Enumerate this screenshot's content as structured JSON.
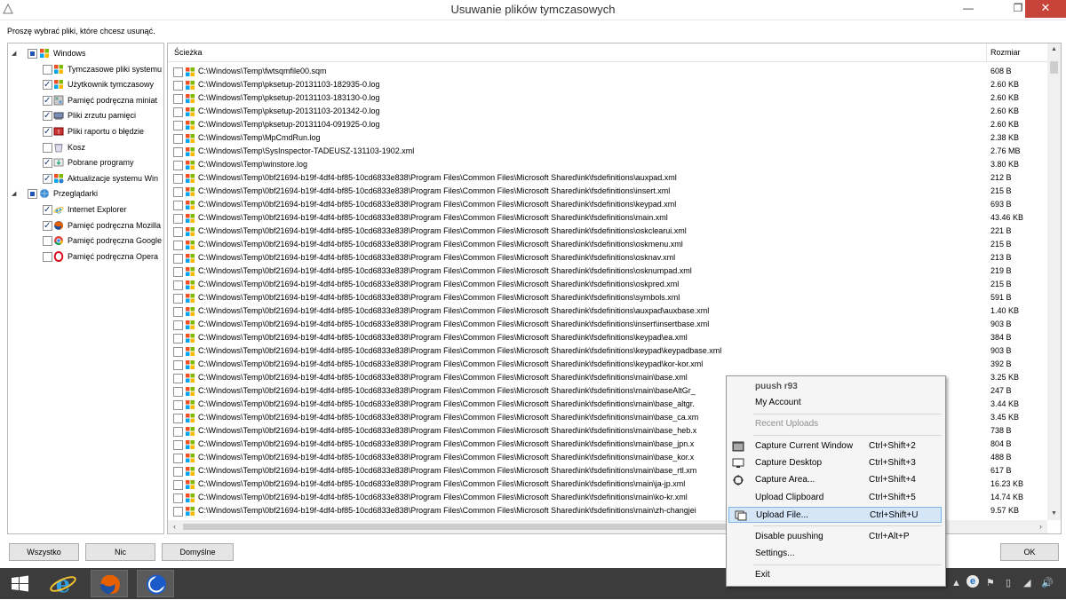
{
  "window": {
    "title": "Usuwanie plików tymczasowych",
    "controls": {
      "minimize": "—",
      "maximize": "❐",
      "close": "✕"
    }
  },
  "instruction": "Proszę wybrać pliki, które chcesz usunąć.",
  "tree": {
    "groups": [
      {
        "label": "Windows",
        "state": "partial",
        "icon": "windows-icon",
        "items": [
          {
            "label": "Tymczasowe pliki systemu",
            "checked": false,
            "icon": "windows-icon"
          },
          {
            "label": "Użytkownik tymczasowy",
            "checked": true,
            "icon": "windows-icon"
          },
          {
            "label": "Pamięć podręczna miniat",
            "checked": true,
            "icon": "thumbnail-icon"
          },
          {
            "label": "Pliki zrzutu pamięci",
            "checked": true,
            "icon": "memory-icon"
          },
          {
            "label": "Pliki raportu o błędzie",
            "checked": true,
            "icon": "error-report-icon"
          },
          {
            "label": "Kosz",
            "checked": false,
            "icon": "recycle-bin-icon"
          },
          {
            "label": "Pobrane programy",
            "checked": true,
            "icon": "download-icon"
          },
          {
            "label": "Aktualizacje systemu Win",
            "checked": true,
            "icon": "windows-update-icon"
          }
        ]
      },
      {
        "label": "Przeglądarki",
        "state": "partial",
        "icon": "browser-icon",
        "items": [
          {
            "label": "Internet Explorer",
            "checked": true,
            "icon": "ie-icon"
          },
          {
            "label": "Pamięć podręczna Mozilla",
            "checked": true,
            "icon": "firefox-icon"
          },
          {
            "label": "Pamięć podręczna Google",
            "checked": false,
            "icon": "chrome-icon"
          },
          {
            "label": "Pamięć podręczna Opera",
            "checked": false,
            "icon": "opera-icon"
          }
        ]
      }
    ]
  },
  "list": {
    "columns": {
      "path": "Ścieżka",
      "size": "Rozmiar"
    },
    "rows": [
      {
        "path": "C:\\Windows\\Temp\\fwtsqmfile00.sqm",
        "size": "608 B"
      },
      {
        "path": "C:\\Windows\\Temp\\pksetup-20131103-182935-0.log",
        "size": "2.60 KB"
      },
      {
        "path": "C:\\Windows\\Temp\\pksetup-20131103-183130-0.log",
        "size": "2.60 KB"
      },
      {
        "path": "C:\\Windows\\Temp\\pksetup-20131103-201342-0.log",
        "size": "2.60 KB"
      },
      {
        "path": "C:\\Windows\\Temp\\pksetup-20131104-091925-0.log",
        "size": "2.60 KB"
      },
      {
        "path": "C:\\Windows\\Temp\\MpCmdRun.log",
        "size": "2.38 KB"
      },
      {
        "path": "C:\\Windows\\Temp\\SysInspector-TADEUSZ-131103-1902.xml",
        "size": "2.76 MB"
      },
      {
        "path": "C:\\Windows\\Temp\\winstore.log",
        "size": "3.80 KB"
      },
      {
        "path": "C:\\Windows\\Temp\\0bf21694-b19f-4df4-bf85-10cd6833e838\\Program Files\\Common Files\\Microsoft Shared\\ink\\fsdefinitions\\auxpad.xml",
        "size": "212 B"
      },
      {
        "path": "C:\\Windows\\Temp\\0bf21694-b19f-4df4-bf85-10cd6833e838\\Program Files\\Common Files\\Microsoft Shared\\ink\\fsdefinitions\\insert.xml",
        "size": "215 B"
      },
      {
        "path": "C:\\Windows\\Temp\\0bf21694-b19f-4df4-bf85-10cd6833e838\\Program Files\\Common Files\\Microsoft Shared\\ink\\fsdefinitions\\keypad.xml",
        "size": "693 B"
      },
      {
        "path": "C:\\Windows\\Temp\\0bf21694-b19f-4df4-bf85-10cd6833e838\\Program Files\\Common Files\\Microsoft Shared\\ink\\fsdefinitions\\main.xml",
        "size": "43.46 KB"
      },
      {
        "path": "C:\\Windows\\Temp\\0bf21694-b19f-4df4-bf85-10cd6833e838\\Program Files\\Common Files\\Microsoft Shared\\ink\\fsdefinitions\\oskclearui.xml",
        "size": "221 B"
      },
      {
        "path": "C:\\Windows\\Temp\\0bf21694-b19f-4df4-bf85-10cd6833e838\\Program Files\\Common Files\\Microsoft Shared\\ink\\fsdefinitions\\oskmenu.xml",
        "size": "215 B"
      },
      {
        "path": "C:\\Windows\\Temp\\0bf21694-b19f-4df4-bf85-10cd6833e838\\Program Files\\Common Files\\Microsoft Shared\\ink\\fsdefinitions\\osknav.xml",
        "size": "213 B"
      },
      {
        "path": "C:\\Windows\\Temp\\0bf21694-b19f-4df4-bf85-10cd6833e838\\Program Files\\Common Files\\Microsoft Shared\\ink\\fsdefinitions\\osknumpad.xml",
        "size": "219 B"
      },
      {
        "path": "C:\\Windows\\Temp\\0bf21694-b19f-4df4-bf85-10cd6833e838\\Program Files\\Common Files\\Microsoft Shared\\ink\\fsdefinitions\\oskpred.xml",
        "size": "215 B"
      },
      {
        "path": "C:\\Windows\\Temp\\0bf21694-b19f-4df4-bf85-10cd6833e838\\Program Files\\Common Files\\Microsoft Shared\\ink\\fsdefinitions\\symbols.xml",
        "size": "591 B"
      },
      {
        "path": "C:\\Windows\\Temp\\0bf21694-b19f-4df4-bf85-10cd6833e838\\Program Files\\Common Files\\Microsoft Shared\\ink\\fsdefinitions\\auxpad\\auxbase.xml",
        "size": "1.40 KB"
      },
      {
        "path": "C:\\Windows\\Temp\\0bf21694-b19f-4df4-bf85-10cd6833e838\\Program Files\\Common Files\\Microsoft Shared\\ink\\fsdefinitions\\insert\\insertbase.xml",
        "size": "903 B"
      },
      {
        "path": "C:\\Windows\\Temp\\0bf21694-b19f-4df4-bf85-10cd6833e838\\Program Files\\Common Files\\Microsoft Shared\\ink\\fsdefinitions\\keypad\\ea.xml",
        "size": "384 B"
      },
      {
        "path": "C:\\Windows\\Temp\\0bf21694-b19f-4df4-bf85-10cd6833e838\\Program Files\\Common Files\\Microsoft Shared\\ink\\fsdefinitions\\keypad\\keypadbase.xml",
        "size": "903 B"
      },
      {
        "path": "C:\\Windows\\Temp\\0bf21694-b19f-4df4-bf85-10cd6833e838\\Program Files\\Common Files\\Microsoft Shared\\ink\\fsdefinitions\\keypad\\kor-kor.xml",
        "size": "392 B"
      },
      {
        "path": "C:\\Windows\\Temp\\0bf21694-b19f-4df4-bf85-10cd6833e838\\Program Files\\Common Files\\Microsoft Shared\\ink\\fsdefinitions\\main\\base.xml",
        "size": "3.25 KB"
      },
      {
        "path": "C:\\Windows\\Temp\\0bf21694-b19f-4df4-bf85-10cd6833e838\\Program Files\\Common Files\\Microsoft Shared\\ink\\fsdefinitions\\main\\baseAltGr_",
        "size": "247 B"
      },
      {
        "path": "C:\\Windows\\Temp\\0bf21694-b19f-4df4-bf85-10cd6833e838\\Program Files\\Common Files\\Microsoft Shared\\ink\\fsdefinitions\\main\\base_altgr.",
        "size": "3.44 KB"
      },
      {
        "path": "C:\\Windows\\Temp\\0bf21694-b19f-4df4-bf85-10cd6833e838\\Program Files\\Common Files\\Microsoft Shared\\ink\\fsdefinitions\\main\\base_ca.xm",
        "size": "3.45 KB"
      },
      {
        "path": "C:\\Windows\\Temp\\0bf21694-b19f-4df4-bf85-10cd6833e838\\Program Files\\Common Files\\Microsoft Shared\\ink\\fsdefinitions\\main\\base_heb.x",
        "size": "738 B"
      },
      {
        "path": "C:\\Windows\\Temp\\0bf21694-b19f-4df4-bf85-10cd6833e838\\Program Files\\Common Files\\Microsoft Shared\\ink\\fsdefinitions\\main\\base_jpn.x",
        "size": "804 B"
      },
      {
        "path": "C:\\Windows\\Temp\\0bf21694-b19f-4df4-bf85-10cd6833e838\\Program Files\\Common Files\\Microsoft Shared\\ink\\fsdefinitions\\main\\base_kor.x",
        "size": "488 B"
      },
      {
        "path": "C:\\Windows\\Temp\\0bf21694-b19f-4df4-bf85-10cd6833e838\\Program Files\\Common Files\\Microsoft Shared\\ink\\fsdefinitions\\main\\base_rtl.xm",
        "size": "617 B"
      },
      {
        "path": "C:\\Windows\\Temp\\0bf21694-b19f-4df4-bf85-10cd6833e838\\Program Files\\Common Files\\Microsoft Shared\\ink\\fsdefinitions\\main\\ja-jp.xml",
        "size": "16.23 KB"
      },
      {
        "path": "C:\\Windows\\Temp\\0bf21694-b19f-4df4-bf85-10cd6833e838\\Program Files\\Common Files\\Microsoft Shared\\ink\\fsdefinitions\\main\\ko-kr.xml",
        "size": "14.74 KB"
      },
      {
        "path": "C:\\Windows\\Temp\\0bf21694-b19f-4df4-bf85-10cd6833e838\\Program Files\\Common Files\\Microsoft Shared\\ink\\fsdefinitions\\main\\zh-changjei",
        "size": "9.57 KB"
      }
    ]
  },
  "buttons": {
    "all": "Wszystko",
    "none": "Nic",
    "default": "Domyślne",
    "ok": "OK"
  },
  "context_menu": {
    "header": "puush r93",
    "my_account": "My Account",
    "recent_uploads": "Recent Uploads",
    "capture_window": {
      "label": "Capture Current Window",
      "shortcut": "Ctrl+Shift+2"
    },
    "capture_desktop": {
      "label": "Capture Desktop",
      "shortcut": "Ctrl+Shift+3"
    },
    "capture_area": {
      "label": "Capture Area...",
      "shortcut": "Ctrl+Shift+4"
    },
    "upload_clipboard": {
      "label": "Upload Clipboard",
      "shortcut": "Ctrl+Shift+5"
    },
    "upload_file": {
      "label": "Upload File...",
      "shortcut": "Ctrl+Shift+U"
    },
    "disable": {
      "label": "Disable puushing",
      "shortcut": "Ctrl+Alt+P"
    },
    "settings": "Settings...",
    "exit": "Exit"
  },
  "taskbar": {
    "apps": [
      "start-icon",
      "ie-icon",
      "firefox-icon",
      "moon-app-icon"
    ],
    "tray": [
      "puush-tray-icon",
      "chevron-up-icon",
      "flag-icon",
      "battery-icon",
      "network-icon",
      "volume-icon"
    ]
  },
  "colors": {
    "menu_highlight": "#d5e6f9",
    "close_button": "#c7443a",
    "taskbar": "#3c3c3c"
  }
}
